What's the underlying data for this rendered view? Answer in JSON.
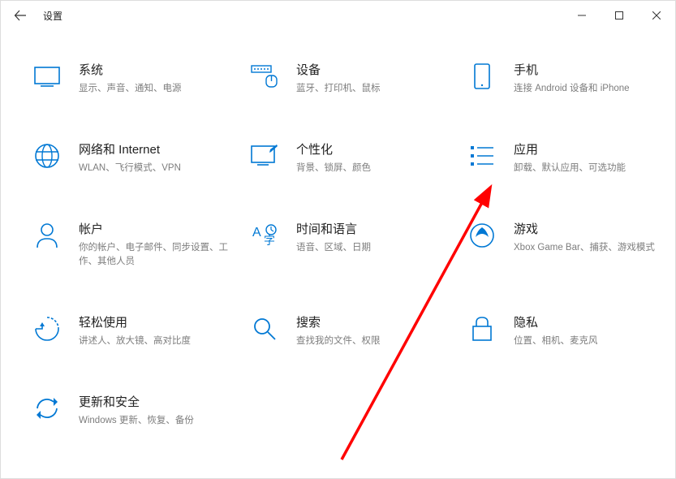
{
  "window_title": "设置",
  "categories": [
    {
      "id": "system",
      "title": "系统",
      "desc": "显示、声音、通知、电源"
    },
    {
      "id": "devices",
      "title": "设备",
      "desc": "蓝牙、打印机、鼠标"
    },
    {
      "id": "phone",
      "title": "手机",
      "desc": "连接 Android 设备和 iPhone"
    },
    {
      "id": "network",
      "title": "网络和 Internet",
      "desc": "WLAN、飞行模式、VPN"
    },
    {
      "id": "personalization",
      "title": "个性化",
      "desc": "背景、锁屏、颜色"
    },
    {
      "id": "apps",
      "title": "应用",
      "desc": "卸载、默认应用、可选功能"
    },
    {
      "id": "accounts",
      "title": "帐户",
      "desc": "你的帐户、电子邮件、同步设置、工作、其他人员"
    },
    {
      "id": "time",
      "title": "时间和语言",
      "desc": "语音、区域、日期"
    },
    {
      "id": "gaming",
      "title": "游戏",
      "desc": "Xbox Game Bar、捕获、游戏模式"
    },
    {
      "id": "ease",
      "title": "轻松使用",
      "desc": "讲述人、放大镜、高对比度"
    },
    {
      "id": "search",
      "title": "搜索",
      "desc": "查找我的文件、权限"
    },
    {
      "id": "privacy",
      "title": "隐私",
      "desc": "位置、相机、麦克风"
    },
    {
      "id": "update",
      "title": "更新和安全",
      "desc": "Windows 更新、恢复、备份"
    }
  ],
  "annotation": {
    "color": "#ff0000"
  }
}
